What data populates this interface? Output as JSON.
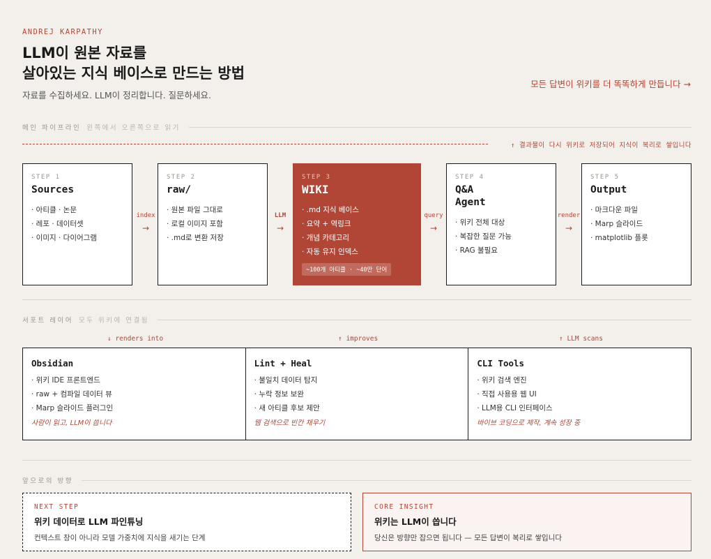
{
  "header": {
    "author": "ANDREJ KARPATHY",
    "title_line1": "LLM이 원본 자료를",
    "title_line2": "살아있는 지식 베이스로 만드는 방법",
    "subtitle": "자료를 수집하세요. LLM이 정리합니다. 질문하세요.",
    "link": "모든 답변이 위키를 더 똑똑하게 만듭니다 →"
  },
  "pipeline": {
    "label": "메인 파이프라인",
    "hint": "왼쪽에서 오른쪽으로 읽기",
    "feedback": "↑ 결과물이 다시 위키로 저장되어 지식이 복리로 쌓입니다",
    "steps": [
      {
        "label": "STEP 1",
        "name": "Sources",
        "items": [
          "· 아티클 · 논문",
          "· 레포 · 데이터셋",
          "· 이미지 · 다이어그램"
        ]
      },
      {
        "label": "STEP 2",
        "name": "raw/",
        "items": [
          "· 원본 파일 그대로",
          "· 로컬 이미지 포함",
          "· .md로 변환 저장"
        ]
      },
      {
        "label": "STEP 3",
        "name": "WIKI",
        "items": [
          "· .md 지식 베이스",
          "· 요약 + 역링크",
          "· 개념 카테고리",
          "· 자동 유지 인덱스"
        ],
        "badge": "~100개 아티클 · ~40만 단어"
      },
      {
        "label": "STEP 4",
        "name_line1": "Q&A",
        "name_line2": "Agent",
        "items": [
          "· 위키 전체 대상",
          "· 복잡한 질문 가능",
          "· RAG 불필요"
        ]
      },
      {
        "label": "STEP 5",
        "name": "Output",
        "items": [
          "· 마크다운 파일",
          "· Marp 슬라이드",
          "· matplotlib 플롯"
        ]
      }
    ],
    "connectors": [
      {
        "label": "index",
        "arrow": "→"
      },
      {
        "label": "LLM",
        "arrow": "→"
      },
      {
        "label": "query",
        "arrow": "→"
      },
      {
        "label": "render",
        "arrow": "→"
      }
    ]
  },
  "support": {
    "label": "서포트 레이어",
    "hint": "모두 위키에 연결됨",
    "annotations": [
      "↓ renders into",
      "↑ improves",
      "↑ LLM scans"
    ],
    "columns": [
      {
        "name": "Obsidian",
        "items": [
          "· 위키 IDE 프론트엔드",
          "· raw + 컴파일 데이터 뷰",
          "· Marp 슬라이드 플러그인"
        ],
        "note": "사람이 읽고, LLM이 씁니다"
      },
      {
        "name": "Lint + Heal",
        "items": [
          "· 불일치 데이터 탐지",
          "· 누락 정보 보완",
          "· 새 아티클 후보 제안"
        ],
        "note": "웹 검색으로 빈칸 채우기"
      },
      {
        "name": "CLI Tools",
        "items": [
          "· 위키 검색 엔진",
          "· 직접 사용용 웹 UI",
          "· LLM용 CLI 인터페이스"
        ],
        "note": "바이브 코딩으로 제작, 계속 성장 중"
      }
    ]
  },
  "future": {
    "label": "앞으로의 방향",
    "cards": [
      {
        "kicker": "NEXT STEP",
        "title": "위키 데이터로 LLM 파인튜닝",
        "desc": "컨텍스트 창이 아니라 모델 가중치에 지식을 새기는 단계"
      },
      {
        "kicker": "CORE INSIGHT",
        "title": "위키는 LLM이 씁니다",
        "desc": "당신은 방향만 잡으면 됩니다 — 모든 답변이 복리로 쌓입니다"
      }
    ]
  },
  "colors": {
    "accent": "#b24636",
    "background": "#f3f0eb"
  }
}
